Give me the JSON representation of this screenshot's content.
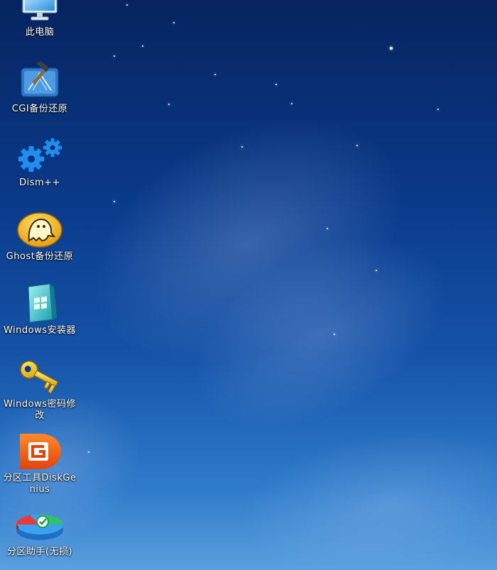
{
  "desktop": {
    "icons": [
      {
        "label": "此电脑",
        "icon": "computer-icon"
      },
      {
        "label": "CGI备份还原",
        "icon": "cgi-backup-icon"
      },
      {
        "label": "Dism++",
        "icon": "gears-icon"
      },
      {
        "label": "Ghost备份还原",
        "icon": "ghost-icon"
      },
      {
        "label": "Windows安装器",
        "icon": "windows-installer-icon"
      },
      {
        "label": "Windows密码修改",
        "icon": "key-icon"
      },
      {
        "label": "分区工具DiskGenius",
        "icon": "diskgenius-icon"
      },
      {
        "label": "分区助手(无损)",
        "icon": "partition-assistant-icon"
      }
    ]
  },
  "colors": {
    "sky_top": "#06245f",
    "sky_bottom": "#5a9fde",
    "label_text": "#ffffff"
  }
}
